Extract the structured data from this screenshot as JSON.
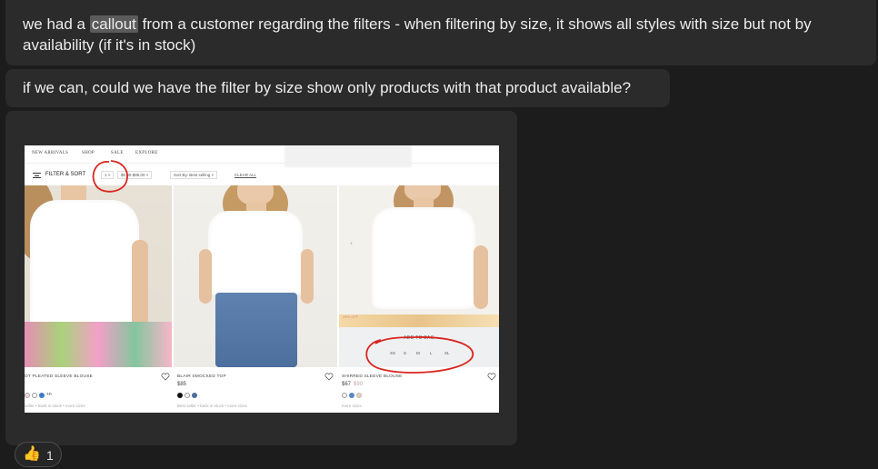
{
  "messages": [
    {
      "before": "we had a ",
      "highlight": "callout",
      "after": " from a customer regarding the filters - when filtering by size, it shows all styles with size but not by availability (if it's in stock)"
    },
    {
      "text": "if we can, could we have the filter by size show only products with that product available?"
    }
  ],
  "screenshot": {
    "nav": [
      "NEW ARRIVALS",
      "SHOP",
      "SALE",
      "EXPLORE"
    ],
    "filter_label": "FILTER & SORT",
    "chips": [
      "1  ×",
      "$0.00-$95.00  ×",
      "Sort By: Best selling  ×"
    ],
    "clear_all": "CLEAR ALL",
    "products": [
      {
        "name": "OT PLEATED SLEEVE BLOUSE",
        "price": "",
        "was": "",
        "swatch_more": "+n",
        "meta": "seller • back in stock • more sizes"
      },
      {
        "name": "BLAIR SMOCKED TOP",
        "price": "$85",
        "was": "",
        "swatch_more": "",
        "meta": "Best seller • back in stock • more sizes"
      },
      {
        "name": "SHIRRED SLEEVE BLOUSE",
        "price": "$67",
        "was": "$90",
        "swatch_more": "",
        "meta": "more sizes"
      }
    ],
    "sale_tag": "29% OFF",
    "add_to_bag": "ADD TO BAG",
    "sizes": [
      "XS",
      "S",
      "M",
      "L",
      "XL"
    ],
    "annotation_color": "#d8261f"
  },
  "reaction": {
    "emoji": "👍",
    "count": "1"
  }
}
